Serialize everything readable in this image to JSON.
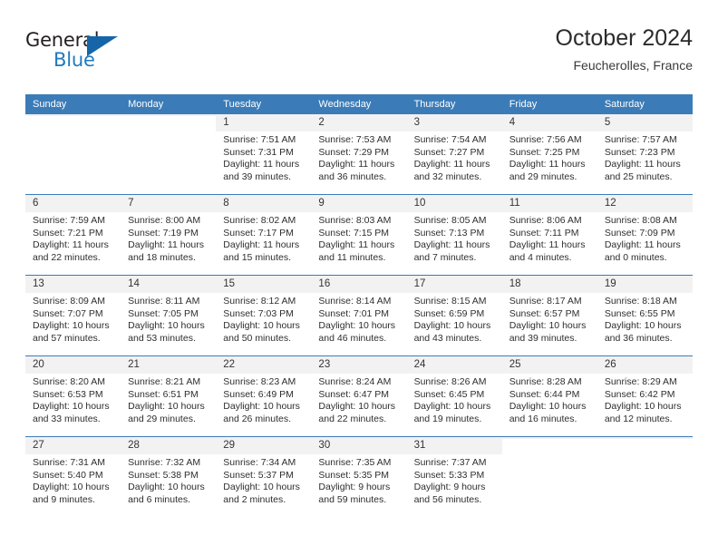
{
  "brand": {
    "name_part1": "General",
    "name_part2": "Blue",
    "triangle_icon": "brand-triangle-icon",
    "color_dark": "#231f20",
    "color_blue": "#1f7ac0"
  },
  "header": {
    "title": "October 2024",
    "subtitle": "Feucherolles, France",
    "accent_color": "#3b7cb8"
  },
  "calendar": {
    "weekdays": [
      "Sunday",
      "Monday",
      "Tuesday",
      "Wednesday",
      "Thursday",
      "Friday",
      "Saturday"
    ],
    "labels": {
      "sunrise": "Sunrise:",
      "sunset": "Sunset:",
      "daylight": "Daylight:"
    },
    "weeks": [
      [
        {
          "day": "",
          "empty": true
        },
        {
          "day": "",
          "empty": true
        },
        {
          "day": "1",
          "sunrise": "Sunrise: 7:51 AM",
          "sunset": "Sunset: 7:31 PM",
          "daylight_1": "Daylight: 11 hours",
          "daylight_2": "and 39 minutes."
        },
        {
          "day": "2",
          "sunrise": "Sunrise: 7:53 AM",
          "sunset": "Sunset: 7:29 PM",
          "daylight_1": "Daylight: 11 hours",
          "daylight_2": "and 36 minutes."
        },
        {
          "day": "3",
          "sunrise": "Sunrise: 7:54 AM",
          "sunset": "Sunset: 7:27 PM",
          "daylight_1": "Daylight: 11 hours",
          "daylight_2": "and 32 minutes."
        },
        {
          "day": "4",
          "sunrise": "Sunrise: 7:56 AM",
          "sunset": "Sunset: 7:25 PM",
          "daylight_1": "Daylight: 11 hours",
          "daylight_2": "and 29 minutes."
        },
        {
          "day": "5",
          "sunrise": "Sunrise: 7:57 AM",
          "sunset": "Sunset: 7:23 PM",
          "daylight_1": "Daylight: 11 hours",
          "daylight_2": "and 25 minutes."
        }
      ],
      [
        {
          "day": "6",
          "sunrise": "Sunrise: 7:59 AM",
          "sunset": "Sunset: 7:21 PM",
          "daylight_1": "Daylight: 11 hours",
          "daylight_2": "and 22 minutes."
        },
        {
          "day": "7",
          "sunrise": "Sunrise: 8:00 AM",
          "sunset": "Sunset: 7:19 PM",
          "daylight_1": "Daylight: 11 hours",
          "daylight_2": "and 18 minutes."
        },
        {
          "day": "8",
          "sunrise": "Sunrise: 8:02 AM",
          "sunset": "Sunset: 7:17 PM",
          "daylight_1": "Daylight: 11 hours",
          "daylight_2": "and 15 minutes."
        },
        {
          "day": "9",
          "sunrise": "Sunrise: 8:03 AM",
          "sunset": "Sunset: 7:15 PM",
          "daylight_1": "Daylight: 11 hours",
          "daylight_2": "and 11 minutes."
        },
        {
          "day": "10",
          "sunrise": "Sunrise: 8:05 AM",
          "sunset": "Sunset: 7:13 PM",
          "daylight_1": "Daylight: 11 hours",
          "daylight_2": "and 7 minutes."
        },
        {
          "day": "11",
          "sunrise": "Sunrise: 8:06 AM",
          "sunset": "Sunset: 7:11 PM",
          "daylight_1": "Daylight: 11 hours",
          "daylight_2": "and 4 minutes."
        },
        {
          "day": "12",
          "sunrise": "Sunrise: 8:08 AM",
          "sunset": "Sunset: 7:09 PM",
          "daylight_1": "Daylight: 11 hours",
          "daylight_2": "and 0 minutes."
        }
      ],
      [
        {
          "day": "13",
          "sunrise": "Sunrise: 8:09 AM",
          "sunset": "Sunset: 7:07 PM",
          "daylight_1": "Daylight: 10 hours",
          "daylight_2": "and 57 minutes."
        },
        {
          "day": "14",
          "sunrise": "Sunrise: 8:11 AM",
          "sunset": "Sunset: 7:05 PM",
          "daylight_1": "Daylight: 10 hours",
          "daylight_2": "and 53 minutes."
        },
        {
          "day": "15",
          "sunrise": "Sunrise: 8:12 AM",
          "sunset": "Sunset: 7:03 PM",
          "daylight_1": "Daylight: 10 hours",
          "daylight_2": "and 50 minutes."
        },
        {
          "day": "16",
          "sunrise": "Sunrise: 8:14 AM",
          "sunset": "Sunset: 7:01 PM",
          "daylight_1": "Daylight: 10 hours",
          "daylight_2": "and 46 minutes."
        },
        {
          "day": "17",
          "sunrise": "Sunrise: 8:15 AM",
          "sunset": "Sunset: 6:59 PM",
          "daylight_1": "Daylight: 10 hours",
          "daylight_2": "and 43 minutes."
        },
        {
          "day": "18",
          "sunrise": "Sunrise: 8:17 AM",
          "sunset": "Sunset: 6:57 PM",
          "daylight_1": "Daylight: 10 hours",
          "daylight_2": "and 39 minutes."
        },
        {
          "day": "19",
          "sunrise": "Sunrise: 8:18 AM",
          "sunset": "Sunset: 6:55 PM",
          "daylight_1": "Daylight: 10 hours",
          "daylight_2": "and 36 minutes."
        }
      ],
      [
        {
          "day": "20",
          "sunrise": "Sunrise: 8:20 AM",
          "sunset": "Sunset: 6:53 PM",
          "daylight_1": "Daylight: 10 hours",
          "daylight_2": "and 33 minutes."
        },
        {
          "day": "21",
          "sunrise": "Sunrise: 8:21 AM",
          "sunset": "Sunset: 6:51 PM",
          "daylight_1": "Daylight: 10 hours",
          "daylight_2": "and 29 minutes."
        },
        {
          "day": "22",
          "sunrise": "Sunrise: 8:23 AM",
          "sunset": "Sunset: 6:49 PM",
          "daylight_1": "Daylight: 10 hours",
          "daylight_2": "and 26 minutes."
        },
        {
          "day": "23",
          "sunrise": "Sunrise: 8:24 AM",
          "sunset": "Sunset: 6:47 PM",
          "daylight_1": "Daylight: 10 hours",
          "daylight_2": "and 22 minutes."
        },
        {
          "day": "24",
          "sunrise": "Sunrise: 8:26 AM",
          "sunset": "Sunset: 6:45 PM",
          "daylight_1": "Daylight: 10 hours",
          "daylight_2": "and 19 minutes."
        },
        {
          "day": "25",
          "sunrise": "Sunrise: 8:28 AM",
          "sunset": "Sunset: 6:44 PM",
          "daylight_1": "Daylight: 10 hours",
          "daylight_2": "and 16 minutes."
        },
        {
          "day": "26",
          "sunrise": "Sunrise: 8:29 AM",
          "sunset": "Sunset: 6:42 PM",
          "daylight_1": "Daylight: 10 hours",
          "daylight_2": "and 12 minutes."
        }
      ],
      [
        {
          "day": "27",
          "sunrise": "Sunrise: 7:31 AM",
          "sunset": "Sunset: 5:40 PM",
          "daylight_1": "Daylight: 10 hours",
          "daylight_2": "and 9 minutes."
        },
        {
          "day": "28",
          "sunrise": "Sunrise: 7:32 AM",
          "sunset": "Sunset: 5:38 PM",
          "daylight_1": "Daylight: 10 hours",
          "daylight_2": "and 6 minutes."
        },
        {
          "day": "29",
          "sunrise": "Sunrise: 7:34 AM",
          "sunset": "Sunset: 5:37 PM",
          "daylight_1": "Daylight: 10 hours",
          "daylight_2": "and 2 minutes."
        },
        {
          "day": "30",
          "sunrise": "Sunrise: 7:35 AM",
          "sunset": "Sunset: 5:35 PM",
          "daylight_1": "Daylight: 9 hours",
          "daylight_2": "and 59 minutes."
        },
        {
          "day": "31",
          "sunrise": "Sunrise: 7:37 AM",
          "sunset": "Sunset: 5:33 PM",
          "daylight_1": "Daylight: 9 hours",
          "daylight_2": "and 56 minutes."
        },
        {
          "day": "",
          "empty": true
        },
        {
          "day": "",
          "empty": true
        }
      ]
    ]
  }
}
